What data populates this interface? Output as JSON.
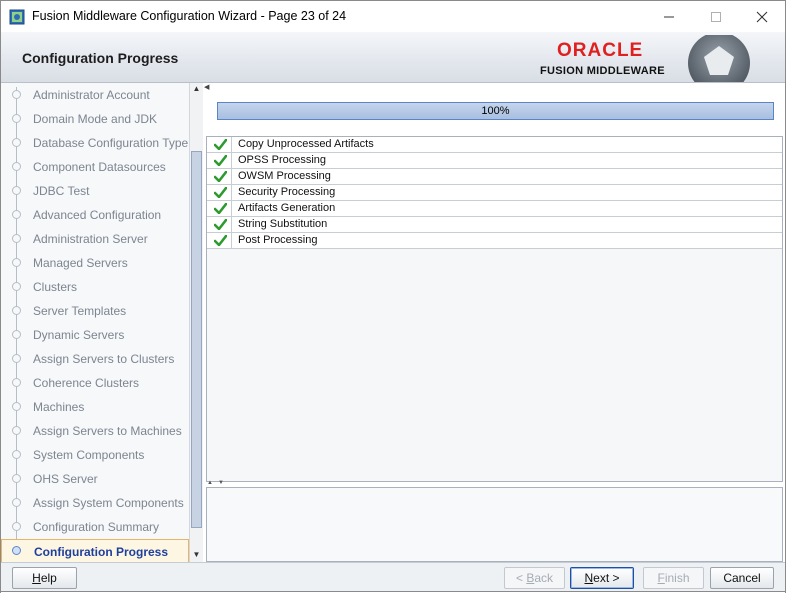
{
  "window": {
    "title": "Fusion Middleware Configuration Wizard - Page 23 of 24",
    "app_icon": "installer-icon",
    "controls": [
      "minimize-icon",
      "maximize-icon",
      "close-icon"
    ]
  },
  "header": {
    "title": "Configuration Progress",
    "logo_brand": "ORACLE",
    "logo_product": "FUSION MIDDLEWARE",
    "brand_color": "#e01f1f"
  },
  "nav": {
    "items": [
      {
        "label": "Administrator Account"
      },
      {
        "label": "Domain Mode and JDK"
      },
      {
        "label": "Database Configuration Type"
      },
      {
        "label": "Component Datasources"
      },
      {
        "label": "JDBC Test"
      },
      {
        "label": "Advanced Configuration"
      },
      {
        "label": "Administration Server"
      },
      {
        "label": "Managed Servers"
      },
      {
        "label": "Clusters"
      },
      {
        "label": "Server Templates"
      },
      {
        "label": "Dynamic Servers"
      },
      {
        "label": "Assign Servers to Clusters"
      },
      {
        "label": "Coherence Clusters"
      },
      {
        "label": "Machines"
      },
      {
        "label": "Assign Servers to Machines"
      },
      {
        "label": "System Components"
      },
      {
        "label": "OHS Server"
      },
      {
        "label": "Assign System Components"
      },
      {
        "label": "Configuration Summary"
      },
      {
        "label": "Configuration Progress"
      }
    ],
    "active_label": "Configuration Progress"
  },
  "progress": {
    "percent_text": "100%",
    "value": 1.0
  },
  "tasks": [
    {
      "label": "Copy Unprocessed Artifacts",
      "status_icon": "check-icon"
    },
    {
      "label": "OPSS Processing",
      "status_icon": "check-icon"
    },
    {
      "label": "OWSM Processing",
      "status_icon": "check-icon"
    },
    {
      "label": "Security Processing",
      "status_icon": "check-icon"
    },
    {
      "label": "Artifacts Generation",
      "status_icon": "check-icon"
    },
    {
      "label": "String Substitution",
      "status_icon": "check-icon"
    },
    {
      "label": "Post Processing",
      "status_icon": "check-icon"
    }
  ],
  "footer": {
    "help": {
      "pre": "",
      "u": "H",
      "post": "elp"
    },
    "back": {
      "pre": "< ",
      "u": "B",
      "post": "ack"
    },
    "next": {
      "pre": "",
      "u": "N",
      "post": "ext >"
    },
    "finish": {
      "pre": "",
      "u": "F",
      "post": "inish"
    },
    "cancel": {
      "pre": "Cancel",
      "u": "",
      "post": ""
    }
  },
  "colors": {
    "progress_border": "#5a84c2",
    "active_nav_text": "#1f3f9e",
    "check_green": "#2f9a2f"
  }
}
